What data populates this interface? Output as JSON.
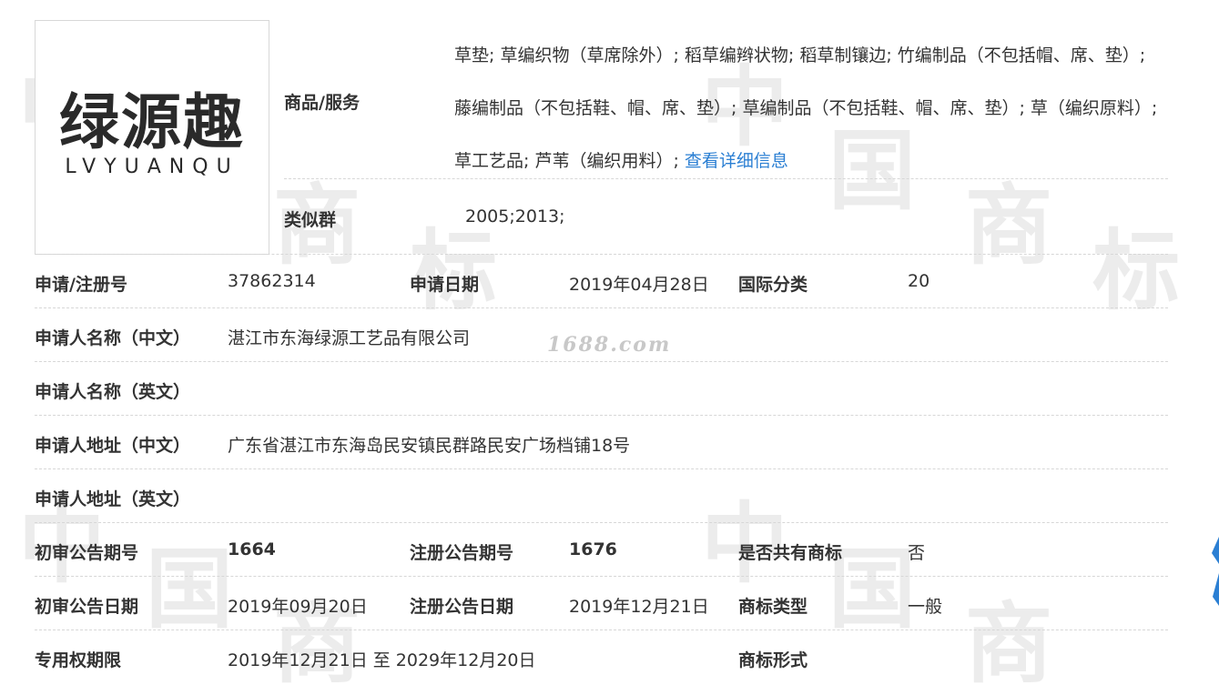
{
  "logo": {
    "text_cn": "绿源趣",
    "text_en": "LVYUANQU"
  },
  "goods": {
    "label": "商品/服务",
    "text": "草垫; 草编织物（草席除外）; 稻草编辫状物; 稻草制镶边; 竹编制品（不包括帽、席、垫）; 藤编制品（不包括鞋、帽、席、垫）; 草编制品（不包括鞋、帽、席、垫）; 草（编织原料）; 草工艺品; 芦苇（编织用料）; ",
    "more_link": "查看详细信息"
  },
  "similar": {
    "label": "类似群",
    "value": "2005;2013;"
  },
  "rows": {
    "reg_no": {
      "label": "申请/注册号",
      "value": "37862314"
    },
    "apply_date": {
      "label": "申请日期",
      "value": "2019年04月28日"
    },
    "intl_class": {
      "label": "国际分类",
      "value": "20"
    },
    "applicant_cn": {
      "label": "申请人名称（中文）",
      "value": "湛江市东海绿源工艺品有限公司"
    },
    "applicant_en": {
      "label": "申请人名称（英文）",
      "value": ""
    },
    "address_cn": {
      "label": "申请人地址（中文）",
      "value": "广东省湛江市东海岛民安镇民群路民安广场档铺18号"
    },
    "address_en": {
      "label": "申请人地址（英文）",
      "value": ""
    },
    "prelim_issue": {
      "label": "初审公告期号",
      "value": "1664"
    },
    "reg_issue": {
      "label": "注册公告期号",
      "value": "1676"
    },
    "shared": {
      "label": "是否共有商标",
      "value": "否"
    },
    "prelim_date": {
      "label": "初审公告日期",
      "value": "2019年09月20日"
    },
    "reg_date": {
      "label": "注册公告日期",
      "value": "2019年12月21日"
    },
    "tm_type": {
      "label": "商标类型",
      "value": "一般"
    },
    "exclusive_period": {
      "label": "专用权期限",
      "value": "2019年12月21日 至 2029年12月20日"
    },
    "tm_form": {
      "label": "商标形式",
      "value": ""
    }
  },
  "watermark": {
    "site": "1688.com"
  },
  "colors": {
    "link": "#2b7fd3",
    "text": "#333333",
    "divider": "#d7d7d7",
    "watermark": "#ececec"
  }
}
